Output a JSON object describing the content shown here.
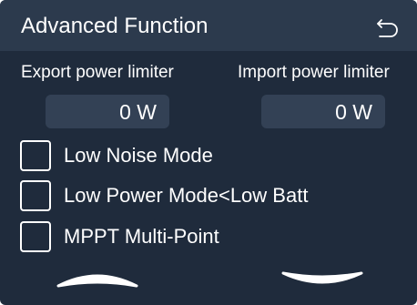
{
  "header": {
    "title": "Advanced Function",
    "back_icon": "back-arrow-icon"
  },
  "limiters": {
    "export": {
      "label": "Export power limiter",
      "value": "0 W"
    },
    "import": {
      "label": "Import power limiter",
      "value": "0 W"
    }
  },
  "options": [
    {
      "label": "Low Noise Mode",
      "checked": false
    },
    {
      "label": "Low Power Mode<Low Batt",
      "checked": false
    },
    {
      "label": "MPPT Multi-Point",
      "checked": false
    }
  ],
  "navigation": {
    "up_icon": "chevron-up-icon",
    "down_icon": "chevron-down-icon"
  },
  "colors": {
    "background": "#1f2b3c",
    "header": "#2c3a4d",
    "field": "#334155",
    "text": "#ffffff"
  }
}
